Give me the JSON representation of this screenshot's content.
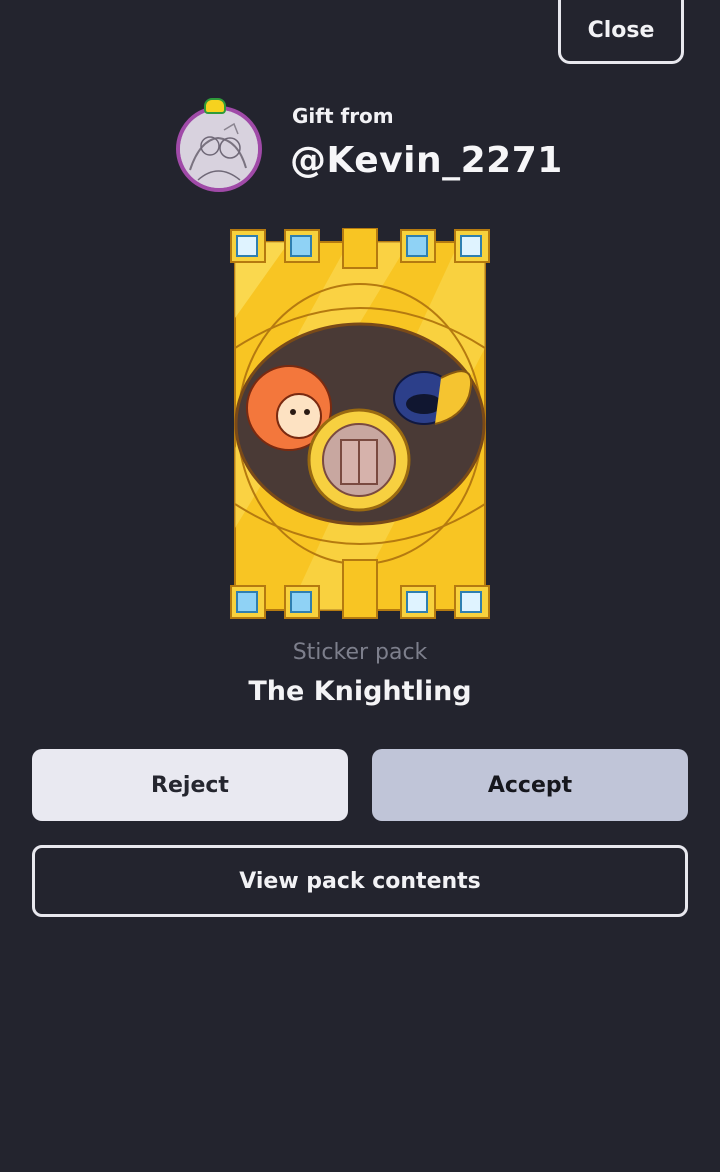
{
  "header": {
    "close_label": "Close"
  },
  "gift": {
    "from_label": "Gift from",
    "sender": "@Kevin_2271"
  },
  "pack": {
    "type_label": "Sticker pack",
    "name": "The Knightling"
  },
  "actions": {
    "reject_label": "Reject",
    "accept_label": "Accept",
    "view_contents_label": "View pack contents"
  },
  "colors": {
    "background": "#23242e",
    "reject_bg": "#e9e9f1",
    "accept_bg": "#c0c5d8",
    "outline": "#e8e8ee",
    "muted_text": "#7d7f8c",
    "card_gold": "#f8c523"
  }
}
